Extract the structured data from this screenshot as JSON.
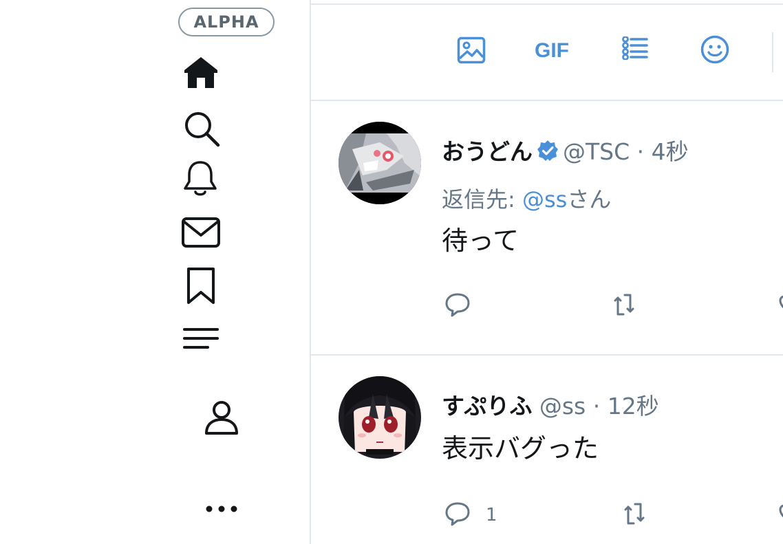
{
  "nav": {
    "badge": "ALPHA",
    "items": [
      {
        "icon": "home-icon",
        "label": "Home"
      },
      {
        "icon": "search-icon",
        "label": "Explore"
      },
      {
        "icon": "bell-icon",
        "label": "Notifications"
      },
      {
        "icon": "mail-icon",
        "label": "Messages"
      },
      {
        "icon": "bookmark-icon",
        "label": "Bookmarks"
      },
      {
        "icon": "lists-icon",
        "label": "Lists"
      },
      {
        "icon": "profile-icon",
        "label": "Profile"
      },
      {
        "icon": "more-icon",
        "label": "More"
      }
    ]
  },
  "compose": {
    "tools": [
      "image-icon",
      "gif-button",
      "poll-icon",
      "emoji-icon"
    ],
    "gif_label": "GIF"
  },
  "colors": {
    "accent": "#4a90d9",
    "text": "#14171a",
    "muted": "#657786",
    "border": "#e1e8ed"
  },
  "tweets": [
    {
      "name": "おうどん",
      "verified": true,
      "handle": "@TSC",
      "sep": "·",
      "time": "4秒",
      "reply_prefix": "返信先: ",
      "reply_mention": "@ss",
      "reply_suffix": "さん",
      "text": "待って",
      "reply_count": "",
      "avatar": "anime-avatar-gray"
    },
    {
      "name": "すぷりふ",
      "verified": false,
      "handle": "@ss",
      "sep": "·",
      "time": "12秒",
      "text": "表示バグった",
      "reply_count": "1",
      "avatar": "anime-avatar-dark-hair"
    }
  ]
}
